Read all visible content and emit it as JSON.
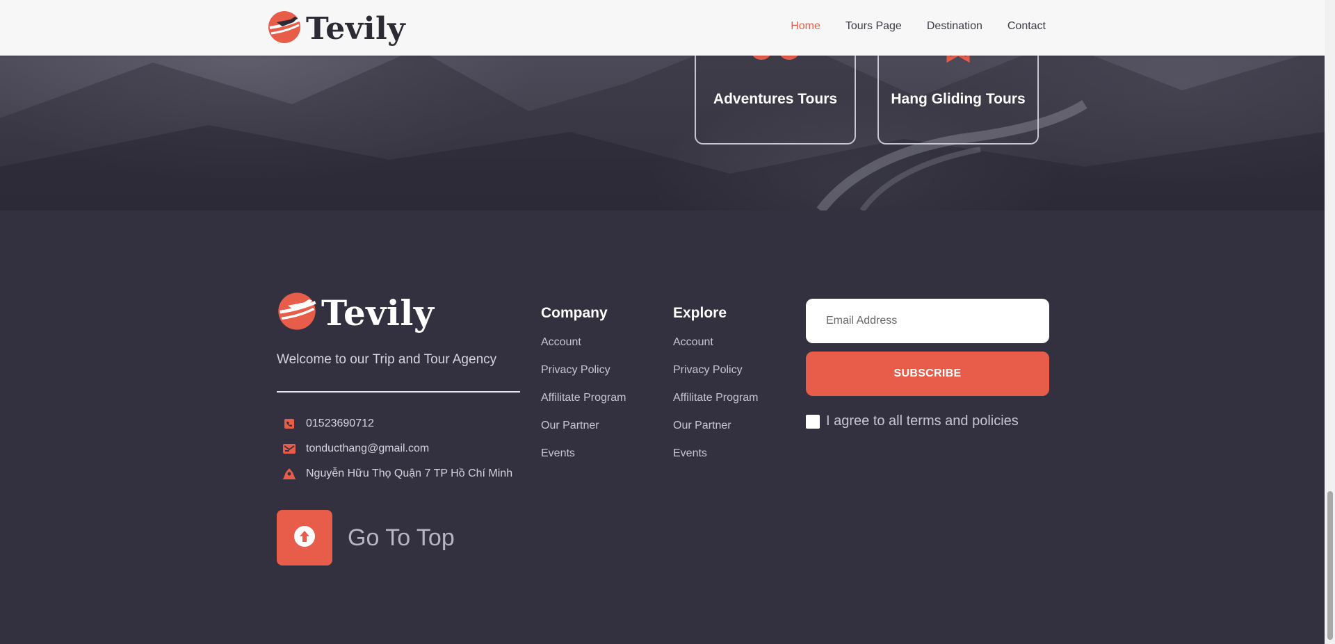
{
  "header": {
    "brand": "Tevily",
    "nav": [
      {
        "label": "Home",
        "active": true
      },
      {
        "label": "Tours Page",
        "active": false
      },
      {
        "label": "Destination",
        "active": false
      },
      {
        "label": "Contact",
        "active": false
      }
    ]
  },
  "tours": [
    {
      "label": "Adventures Tours",
      "icon": "bicycle-icon"
    },
    {
      "label": "Hang Gliding Tours",
      "icon": "glider-icon"
    }
  ],
  "footer": {
    "brand": "Tevily",
    "tagline": "Welcome to our Trip and Tour Agency",
    "contact": {
      "phone": "01523690712",
      "email": "tonducthang@gmail.com",
      "address": "Nguyễn Hữu Thọ Quận 7 TP Hồ Chí Minh"
    },
    "go_to_top": "Go To Top",
    "company": {
      "title": "Company",
      "links": [
        "Account",
        "Privacy Policy",
        "Affilitate Program",
        "Our Partner",
        "Events"
      ]
    },
    "explore": {
      "title": "Explore",
      "links": [
        "Account",
        "Privacy Policy",
        "Affilitate Program",
        "Our Partner",
        "Events"
      ]
    },
    "newsletter": {
      "email_placeholder": "Email Address",
      "subscribe_label": "SUBSCRIBE",
      "agree_label": "I agree to all terms and policies",
      "agree_checked": false
    }
  },
  "colors": {
    "accent": "#e85d4a",
    "footer_bg": "#33313f",
    "header_bg": "#f7f7f7"
  }
}
